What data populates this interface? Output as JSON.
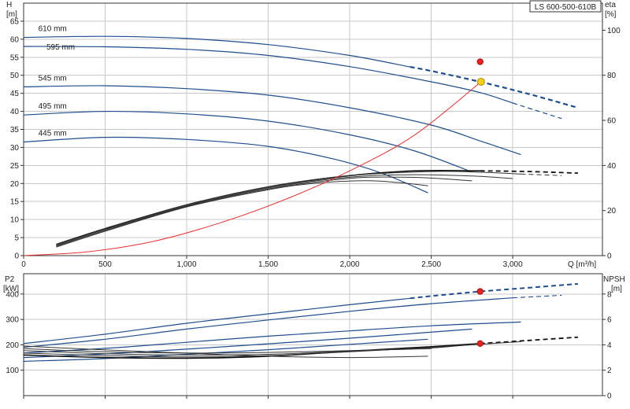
{
  "chart_data": {
    "model_label": "LS 600-500-610B",
    "top": {
      "type": "line",
      "x": {
        "label": "Q [m³/h]",
        "ticks": [
          0,
          500,
          1000,
          1500,
          2000,
          2500,
          3000
        ],
        "tick_labels": [
          "0",
          "500",
          "1,000",
          "1,500",
          "2,000",
          "2,500",
          "3,000"
        ],
        "range": [
          0,
          3550
        ]
      },
      "y_left": {
        "label_top": "H",
        "label_unit": "[m]",
        "ticks": [
          0,
          5,
          10,
          15,
          20,
          25,
          30,
          35,
          40,
          45,
          50,
          55,
          60,
          65
        ],
        "range": [
          0,
          70
        ]
      },
      "y_right": {
        "label_top": "eta",
        "label_unit": "[%]",
        "ticks": [
          0,
          20,
          40,
          60,
          80,
          100
        ],
        "range": [
          0,
          112
        ]
      },
      "grid": true,
      "head_curves": [
        {
          "name": "610 mm",
          "points": [
            [
              0,
              60.5
            ],
            [
              500,
              60.8
            ],
            [
              1000,
              60.2
            ],
            [
              1500,
              58.5
            ],
            [
              2000,
              55.5
            ],
            [
              2500,
              51.2
            ],
            [
              2800,
              48.2
            ],
            [
              3100,
              44.8
            ],
            [
              3400,
              41.0
            ]
          ],
          "solid_until": 2370
        },
        {
          "name": "595 mm",
          "points": [
            [
              0,
              58.0
            ],
            [
              500,
              57.9
            ],
            [
              1000,
              57.2
            ],
            [
              1500,
              55.5
            ],
            [
              2000,
              52.4
            ],
            [
              2500,
              48.2
            ],
            [
              2800,
              45.2
            ],
            [
              3000,
              42.3
            ],
            [
              3300,
              38.0
            ]
          ],
          "solid_until": 3000
        },
        {
          "name": "545 mm",
          "points": [
            [
              0,
              46.8
            ],
            [
              500,
              47.1
            ],
            [
              1000,
              46.3
            ],
            [
              1500,
              44.5
            ],
            [
              2000,
              41.0
            ],
            [
              2500,
              36.2
            ],
            [
              2800,
              31.8
            ],
            [
              3050,
              28.0
            ]
          ],
          "solid_until": 3050
        },
        {
          "name": "495 mm",
          "points": [
            [
              0,
              39.0
            ],
            [
              500,
              40.0
            ],
            [
              1000,
              39.3
            ],
            [
              1500,
              37.3
            ],
            [
              2000,
              33.5
            ],
            [
              2400,
              29.0
            ],
            [
              2750,
              23.2
            ]
          ],
          "solid_until": 2750
        },
        {
          "name": "445 mm",
          "points": [
            [
              0,
              31.5
            ],
            [
              500,
              32.8
            ],
            [
              1000,
              32.2
            ],
            [
              1500,
              30.3
            ],
            [
              1900,
              26.8
            ],
            [
              2200,
              22.8
            ],
            [
              2480,
              17.4
            ]
          ],
          "solid_until": 2480
        }
      ],
      "efficiency_curves": [
        {
          "name": "610 mm",
          "points": [
            [
              200,
              5
            ],
            [
              500,
              12
            ],
            [
              1000,
              22.5
            ],
            [
              1500,
              30.5
            ],
            [
              2000,
              35.5
            ],
            [
              2400,
              37.6
            ],
            [
              2800,
              37.6
            ],
            [
              3100,
              37.3
            ],
            [
              3400,
              36.6
            ]
          ],
          "solid_until": 2800
        },
        {
          "name": "595 mm",
          "points": [
            [
              200,
              5
            ],
            [
              500,
              12
            ],
            [
              1000,
              22.5
            ],
            [
              1500,
              30.5
            ],
            [
              2000,
              35.5
            ],
            [
              2500,
              37.3
            ],
            [
              2800,
              37.0
            ],
            [
              3050,
              36.2
            ],
            [
              3300,
              35.5
            ]
          ],
          "solid_until": 3050
        },
        {
          "name": "545 mm",
          "points": [
            [
              200,
              4.5
            ],
            [
              500,
              11.6
            ],
            [
              1000,
              22
            ],
            [
              1500,
              30
            ],
            [
              2000,
              34.8
            ],
            [
              2400,
              35.9
            ],
            [
              2750,
              35.3
            ],
            [
              3000,
              34.2
            ]
          ],
          "solid_until": 3000
        },
        {
          "name": "495 mm",
          "points": [
            [
              200,
              4.2
            ],
            [
              500,
              11.2
            ],
            [
              1000,
              21.8
            ],
            [
              1500,
              29.6
            ],
            [
              2000,
              34.3
            ],
            [
              2300,
              34.8
            ],
            [
              2500,
              34.4
            ],
            [
              2750,
              33.2
            ]
          ],
          "solid_until": 2750
        },
        {
          "name": "445 mm",
          "points": [
            [
              200,
              3.8
            ],
            [
              500,
              10.8
            ],
            [
              1000,
              21.6
            ],
            [
              1500,
              29.2
            ],
            [
              1800,
              32.2
            ],
            [
              2100,
              33.2
            ],
            [
              2300,
              32.4
            ],
            [
              2480,
              31.0
            ]
          ],
          "solid_until": 2480
        }
      ],
      "system_curve": {
        "color": "#e83030",
        "points": [
          [
            0,
            0
          ],
          [
            400,
            1.1
          ],
          [
            800,
            4.0
          ],
          [
            1200,
            9.0
          ],
          [
            1600,
            15.5
          ],
          [
            2000,
            23.5
          ],
          [
            2400,
            33.5
          ],
          [
            2805,
            48.2
          ]
        ]
      },
      "duty_point": {
        "q": 2805,
        "h": 48.2,
        "color": "#f5d020"
      },
      "efficiency_point": {
        "q": 2800,
        "eta": 86,
        "color": "#e82020"
      }
    },
    "bottom": {
      "type": "line",
      "y_left": {
        "label_top": "P2",
        "label_unit": "[kW]",
        "ticks": [
          100,
          200,
          300,
          400
        ],
        "range": [
          0,
          480
        ]
      },
      "y_right": {
        "label_top": "NPSH",
        "label_unit": "[m]",
        "ticks": [
          0,
          2,
          4,
          6,
          8
        ],
        "range": [
          0,
          9.6
        ]
      },
      "grid": true,
      "power_curves": [
        {
          "name": "610 mm",
          "points": [
            [
              0,
              205
            ],
            [
              500,
              242
            ],
            [
              1000,
              285
            ],
            [
              1500,
              322
            ],
            [
              2000,
              358
            ],
            [
              2500,
              392
            ],
            [
              2800,
              410
            ],
            [
              3100,
              425
            ],
            [
              3400,
              440
            ]
          ],
          "solid_until": 2370
        },
        {
          "name": "595 mm",
          "points": [
            [
              0,
              190
            ],
            [
              500,
              222
            ],
            [
              1000,
              262
            ],
            [
              1500,
              298
            ],
            [
              2000,
              332
            ],
            [
              2500,
              362
            ],
            [
              3000,
              385
            ],
            [
              3300,
              395
            ]
          ],
          "solid_until": 3000
        },
        {
          "name": "545 mm",
          "points": [
            [
              0,
              168
            ],
            [
              500,
              186
            ],
            [
              1000,
              210
            ],
            [
              1500,
              234
            ],
            [
              2000,
              255
            ],
            [
              2500,
              275
            ],
            [
              3050,
              290
            ]
          ],
          "solid_until": 3050
        },
        {
          "name": "495 mm",
          "points": [
            [
              0,
              150
            ],
            [
              500,
              164
            ],
            [
              1000,
              183
            ],
            [
              1500,
              204
            ],
            [
              2000,
              226
            ],
            [
              2400,
              245
            ],
            [
              2750,
              262
            ]
          ],
          "solid_until": 2750
        },
        {
          "name": "445 mm",
          "points": [
            [
              0,
              135
            ],
            [
              500,
              146
            ],
            [
              1000,
              163
            ],
            [
              1500,
              181
            ],
            [
              2000,
              202
            ],
            [
              2480,
              222
            ]
          ],
          "solid_until": 2480
        }
      ],
      "npsh_curves": [
        {
          "name": "610 mm",
          "points": [
            [
              0,
              3.2
            ],
            [
              500,
              3.0
            ],
            [
              1000,
              2.95
            ],
            [
              1500,
              3.1
            ],
            [
              2000,
              3.5
            ],
            [
              2500,
              3.85
            ],
            [
              2800,
              4.1
            ],
            [
              3100,
              4.35
            ],
            [
              3400,
              4.6
            ]
          ],
          "solid_until": 2800
        },
        {
          "name": "595 mm",
          "points": [
            [
              0,
              3.35
            ],
            [
              500,
              3.15
            ],
            [
              1000,
              3.05
            ],
            [
              1500,
              3.15
            ],
            [
              2000,
              3.45
            ],
            [
              2500,
              3.8
            ],
            [
              3050,
              4.25
            ]
          ],
          "solid_until": 3050
        },
        {
          "name": "545 mm",
          "points": [
            [
              0,
              3.55
            ],
            [
              500,
              3.3
            ],
            [
              1000,
              3.2
            ],
            [
              1500,
              3.25
            ],
            [
              2000,
              3.5
            ],
            [
              2500,
              3.75
            ],
            [
              2800,
              4.1
            ]
          ],
          "solid_until": 2800
        },
        {
          "name": "495 mm",
          "points": [
            [
              0,
              3.7
            ],
            [
              500,
              3.45
            ],
            [
              1000,
              3.35
            ],
            [
              1500,
              3.4
            ],
            [
              2000,
              3.55
            ],
            [
              2500,
              3.7
            ]
          ],
          "solid_until": 2500
        },
        {
          "name": "445 mm",
          "points": [
            [
              0,
              3.9
            ],
            [
              500,
              3.6
            ],
            [
              1000,
              3.35
            ],
            [
              1500,
              3.1
            ],
            [
              2000,
              3.0
            ],
            [
              2480,
              3.1
            ]
          ],
          "solid_until": 2480
        }
      ],
      "power_point": {
        "q": 2800,
        "p2": 410,
        "color": "#e82020"
      },
      "npsh_point": {
        "q": 2800,
        "npsh": 4.1,
        "color": "#e82020"
      }
    }
  }
}
